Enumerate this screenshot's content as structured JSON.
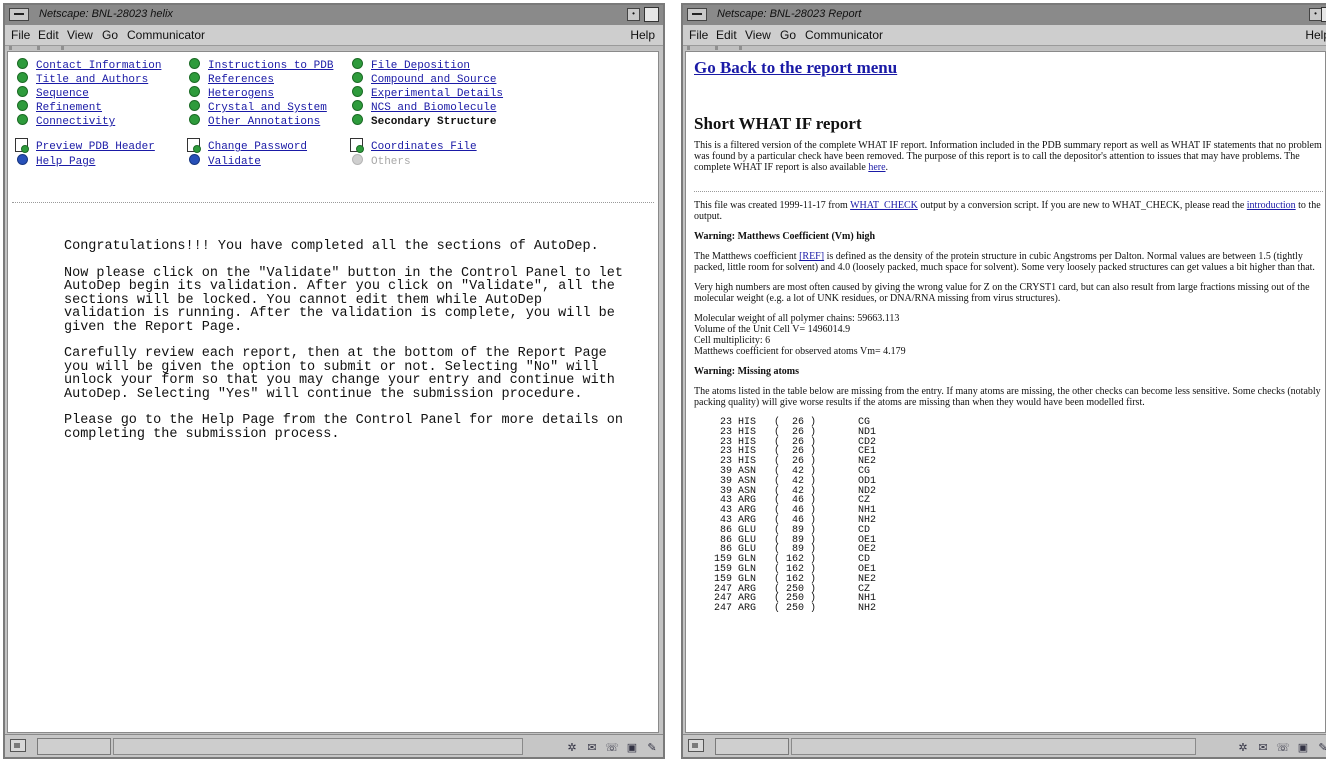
{
  "left_window": {
    "title": "Netscape: BNL-28023 helix",
    "menu": [
      "File",
      "Edit",
      "View",
      "Go",
      "Communicator"
    ],
    "help": "Help",
    "control_panel": {
      "col1": [
        {
          "label": "Contact Information",
          "state": "done"
        },
        {
          "label": "Title and Authors",
          "state": "done"
        },
        {
          "label": "Sequence",
          "state": "done"
        },
        {
          "label": "Refinement",
          "state": "done"
        },
        {
          "label": "Connectivity",
          "state": "done"
        }
      ],
      "col2": [
        {
          "label": "Instructions to PDB",
          "state": "done"
        },
        {
          "label": "References",
          "state": "done"
        },
        {
          "label": "Heterogens",
          "state": "done"
        },
        {
          "label": "Crystal and System",
          "state": "done"
        },
        {
          "label": "Other Annotations",
          "state": "done"
        }
      ],
      "col3": [
        {
          "label": "File Deposition",
          "state": "done"
        },
        {
          "label": "Compound and Source",
          "state": "done"
        },
        {
          "label": "Experimental Details",
          "state": "done"
        },
        {
          "label": "NCS and Biomolecule",
          "state": "done"
        },
        {
          "label": "Secondary Structure",
          "state": "current"
        }
      ],
      "tools": {
        "preview": "Preview PDB Header",
        "change_password": "Change Password",
        "coordinates": "Coordinates File",
        "help_page": "Help Page",
        "validate": "Validate",
        "others": "Others"
      }
    },
    "message": [
      "Congratulations!!! You have completed all the sections of AutoDep.",
      "Now please click on the \"Validate\" button in the Control Panel to let\nAutoDep begin its validation.  After you click on \"Validate\", all the\nsections will be locked.  You cannot edit them while AutoDep\nvalidation is running.  After the validation is complete, you will be\ngiven the Report Page.",
      "Carefully review each report, then at the bottom of the Report Page\nyou will be given the option to submit or not.  Selecting \"No\" will\nunlock your form so that you may change your entry and continue with\nAutoDep.  Selecting \"Yes\" will continue the submission procedure.",
      "Please go to the Help Page from the Control Panel for more details on\ncompleting the submission process."
    ]
  },
  "right_window": {
    "title": "Netscape: BNL-28023 Report",
    "menu": [
      "File",
      "Edit",
      "View",
      "Go",
      "Communicator"
    ],
    "help": "Help",
    "back_link": "Go Back to the report menu",
    "heading": "Short WHAT IF report",
    "intro": "This is a filtered version of the complete WHAT IF report. Information included in the PDB summary report as well as WHAT IF statements that no problem was found by a particular check have been removed. The purpose of this report is to call the depositor's attention to issues that may have problems. The complete WHAT IF report is also available",
    "intro_link": "here",
    "created_pre": "This file was created 1999-11-17 from",
    "created_link": "WHAT_CHECK",
    "created_mid": "output by a conversion script. If you are new to WHAT_CHECK, please read the",
    "created_link2": "introduction",
    "created_post": "to the output.",
    "warn1_title": "Warning: Matthews Coefficient (Vm) high",
    "warn1_pre": "The Matthews coefficient",
    "warn1_ref": "[REF]",
    "warn1_text": "is defined as the density of the protein structure in cubic Angstroms per Dalton. Normal values are between 1.5 (tightly packed, little room for solvent) and 4.0 (loosely packed, much space for solvent). Some very loosely packed structures can get values a bit higher than that.",
    "warn1_para2": "Very high numbers are most often caused by giving the wrong value for Z on the CRYST1 card, but can also result from large fractions missing out of the molecular weight (e.g. a lot of UNK residues, or DNA/RNA missing from virus structures).",
    "stats": [
      "Molecular weight of all polymer chains: 59663.113",
      "Volume of the Unit Cell V= 1496014.9",
      "Cell multiplicity: 6",
      "Matthews coefficient for observed atoms Vm= 4.179"
    ],
    "warn2_title": "Warning: Missing atoms",
    "warn2_text": "The atoms listed in the table below are missing from the entry. If many atoms are missing, the other checks can become less sensitive. Some checks (notably packing quality) will give worse results if the atoms are missing than when they would have been modelled first.",
    "atoms": [
      "  23 HIS   (  26 )       CG",
      "  23 HIS   (  26 )       ND1",
      "  23 HIS   (  26 )       CD2",
      "  23 HIS   (  26 )       CE1",
      "  23 HIS   (  26 )       NE2",
      "  39 ASN   (  42 )       CG",
      "  39 ASN   (  42 )       OD1",
      "  39 ASN   (  42 )       ND2",
      "  43 ARG   (  46 )       CZ",
      "  43 ARG   (  46 )       NH1",
      "  43 ARG   (  46 )       NH2",
      "  86 GLU   (  89 )       CD",
      "  86 GLU   (  89 )       OE1",
      "  86 GLU   (  89 )       OE2",
      " 159 GLN   ( 162 )       CD",
      " 159 GLN   ( 162 )       OE1",
      " 159 GLN   ( 162 )       NE2",
      " 247 ARG   ( 250 )       CZ",
      " 247 ARG   ( 250 )       NH1",
      " 247 ARG   ( 250 )       NH2"
    ]
  }
}
